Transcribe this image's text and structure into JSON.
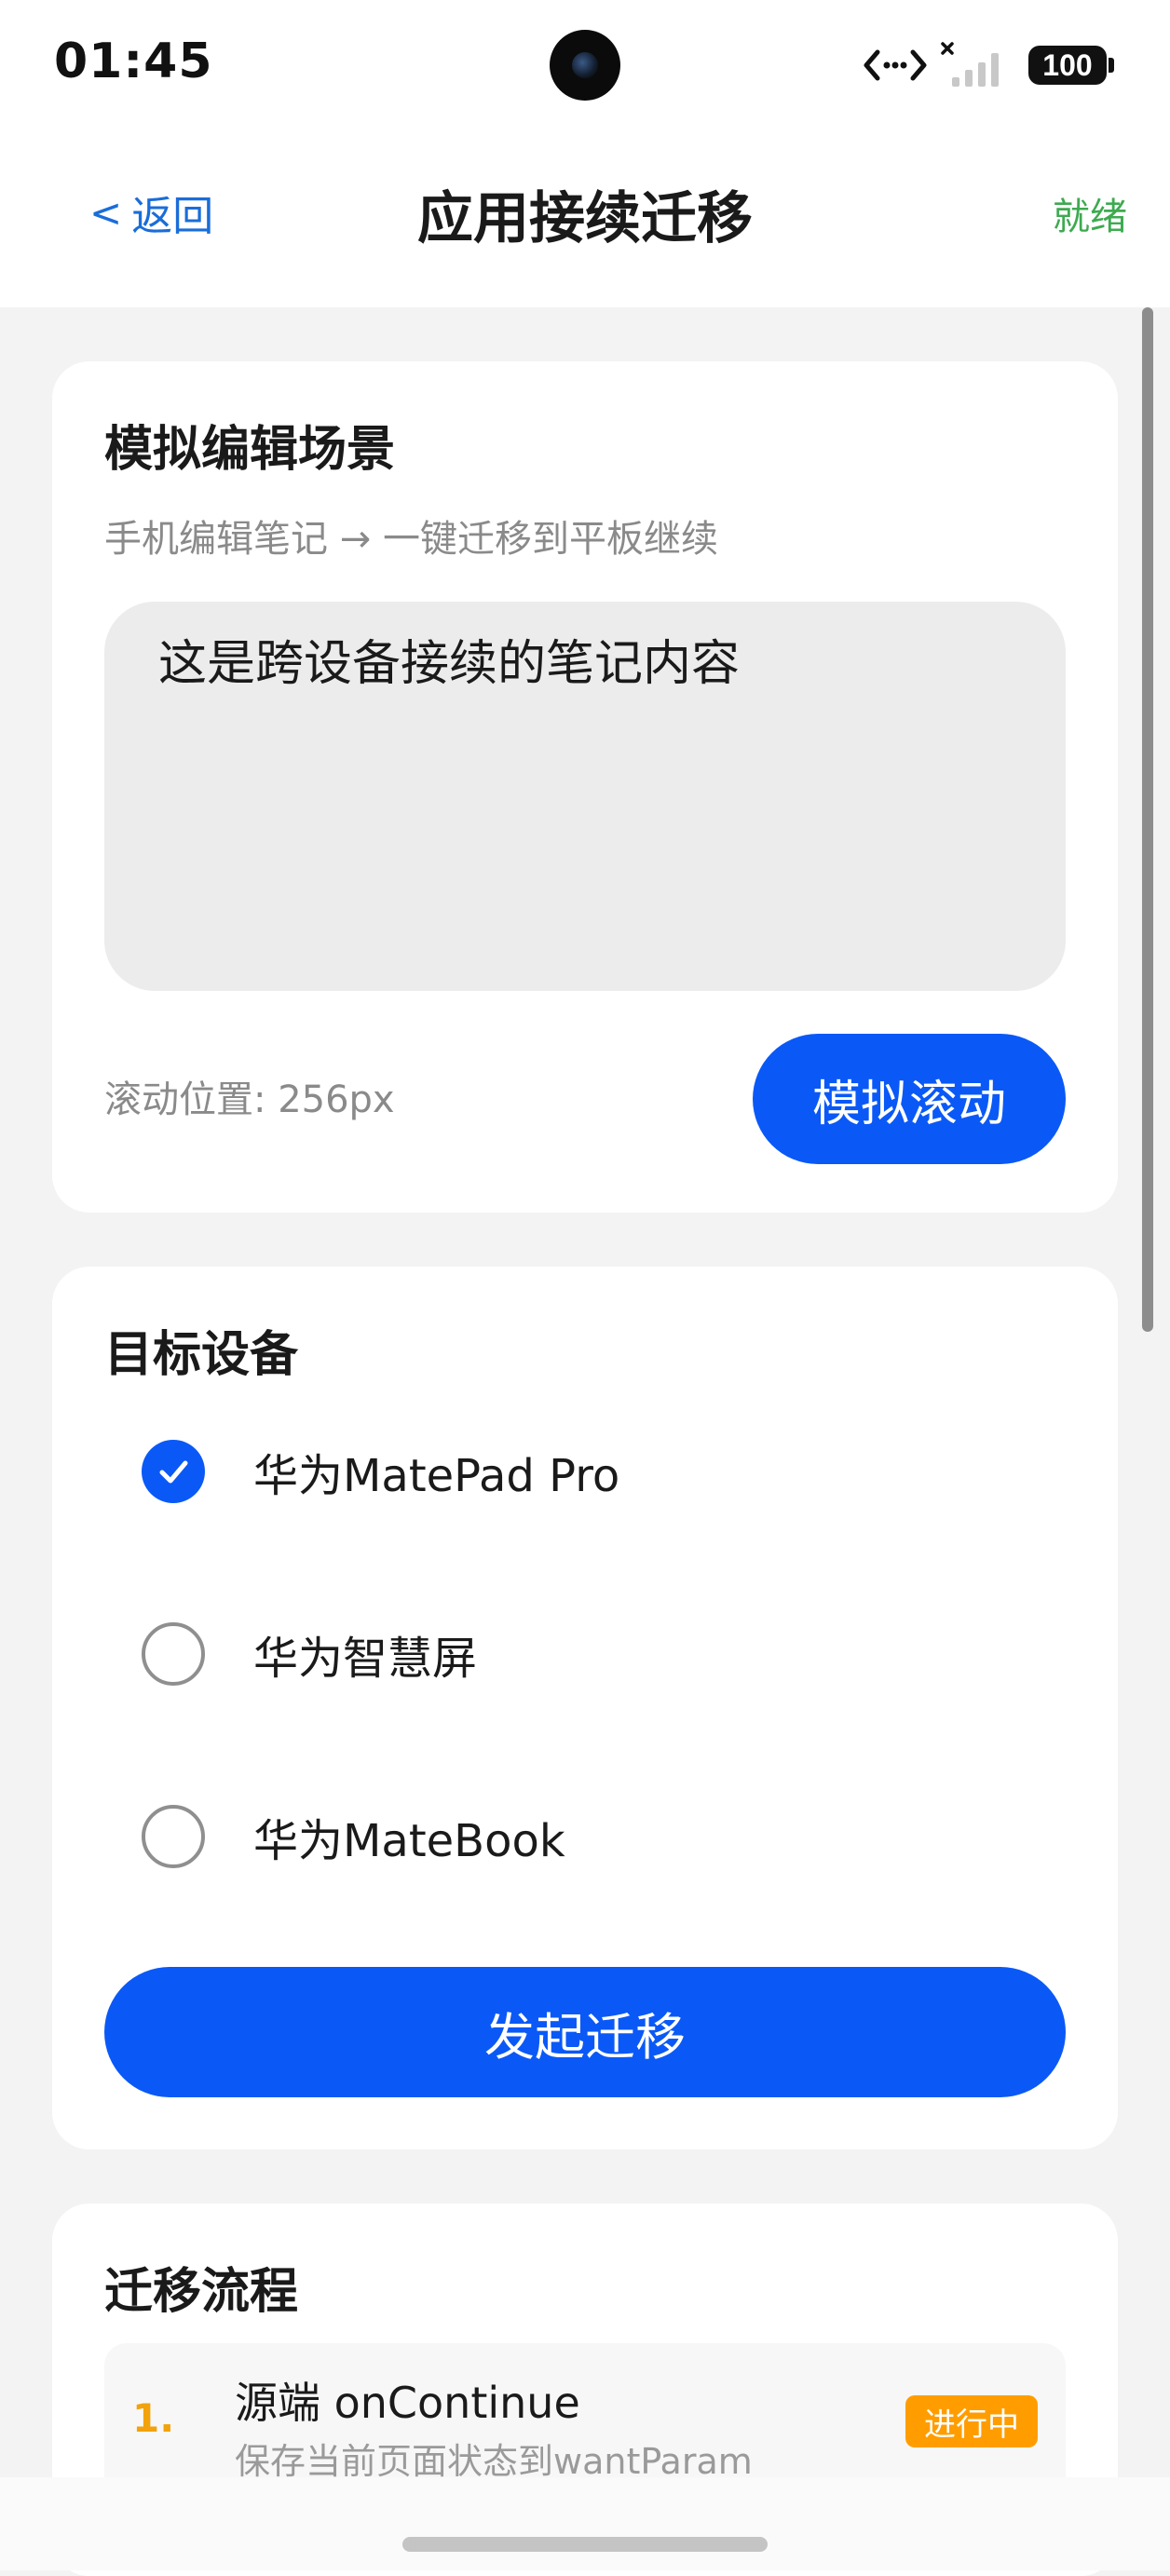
{
  "status_bar": {
    "time": "01:45",
    "battery": "100",
    "icons": [
      "camera-icon",
      "network-transfer-icon",
      "signal-icon",
      "battery-icon"
    ]
  },
  "header": {
    "back_label": "返回",
    "back_chevron": "<",
    "title": "应用接续迁移",
    "status": "就绪"
  },
  "edit_card": {
    "title": "模拟编辑场景",
    "subtitle": "手机编辑笔记 → 一键迁移到平板继续",
    "note_text": "这是跨设备接续的笔记内容",
    "scroll_position": "滚动位置: 256px",
    "simulate_scroll_label": "模拟滚动"
  },
  "devices_card": {
    "title": "目标设备",
    "devices": [
      {
        "label": "华为MatePad Pro",
        "selected": true
      },
      {
        "label": "华为智慧屏",
        "selected": false
      },
      {
        "label": "华为MateBook",
        "selected": false
      }
    ],
    "start_label": "发起迁移"
  },
  "flow_card": {
    "title": "迁移流程",
    "steps": [
      {
        "num": "1.",
        "title": "源端 onContinue",
        "desc": "保存当前页面状态到wantParam",
        "badge": "进行中"
      }
    ]
  },
  "colors": {
    "accent": "#0a59f7",
    "back_link": "#1a6dd9",
    "ready_status": "#3eaa50",
    "in_progress": "#ff9d00",
    "step_number": "#f2a20c"
  }
}
